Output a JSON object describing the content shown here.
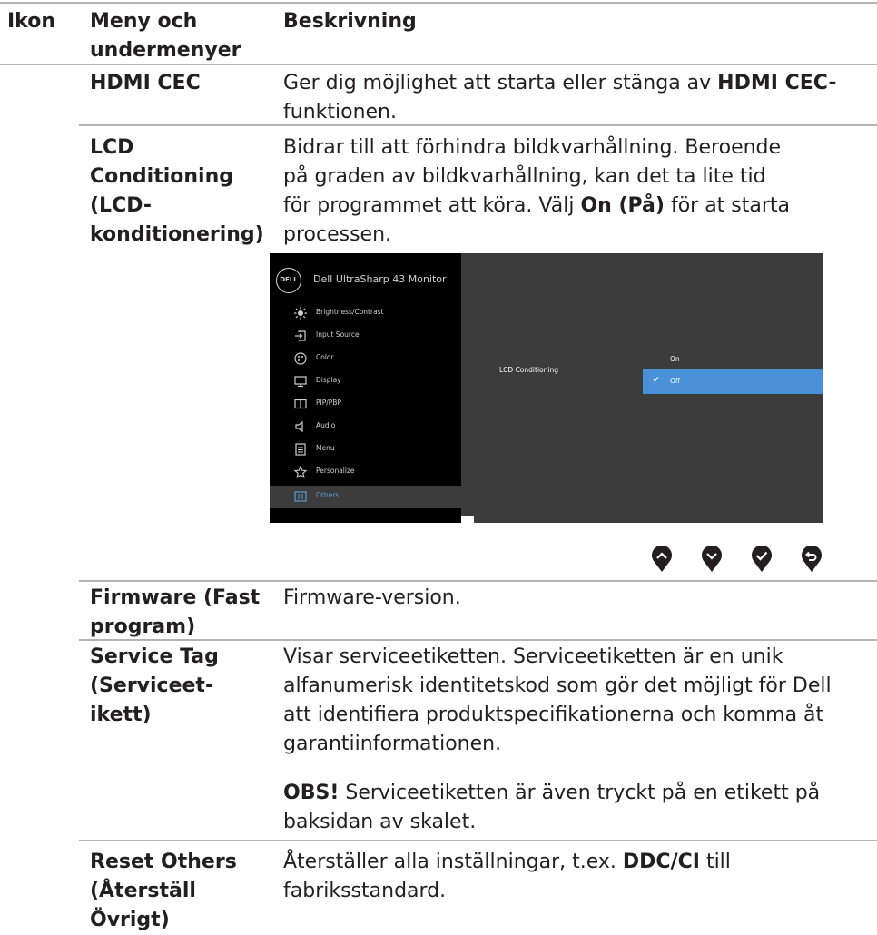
{
  "header": {
    "col_icon": "Ikon",
    "col_menu": "Meny och undermenyer",
    "col_menu_line1": "Meny och",
    "col_menu_line2": "undermenyer",
    "col_desc": "Beskrivning"
  },
  "rows": {
    "hdmi": {
      "menu": "HDMI CEC",
      "desc_prefix": "Ger dig möjlighet att starta eller stänga av ",
      "desc_bold": "HDMI CEC-",
      "desc_line2": "funktionen."
    },
    "lcd": {
      "menu_line1": "LCD",
      "menu_line2": "Conditioning",
      "menu_line3": "(LCD-",
      "menu_line4": "konditionering)",
      "desc_line1": "Bidrar till att förhindra bildkvarhållning. Beroende",
      "desc_line2": "på graden av bildkvarhållning, kan det ta lite tid",
      "desc_line3_prefix": "för programmet att köra. Välj ",
      "desc_line3_bold": "On (På)",
      "desc_line3_suffix": " för at starta",
      "desc_line4": "processen."
    },
    "firmware": {
      "menu_line1": "Firmware (Fast",
      "menu_line2": "program)",
      "desc": "Firmware-version."
    },
    "service": {
      "menu_line1": "Service Tag",
      "menu_line2": "(Serviceet-",
      "menu_line3": "ikett)",
      "desc_line1": "Visar serviceetiketten. Serviceetiketten är en unik",
      "desc_line2": "alfanumerisk identitetskod som gör det möjligt för Dell",
      "desc_line3": "att identifiera produktspecifikationerna och komma åt",
      "desc_line4": "garantiinformationen.",
      "note_bold": "OBS!",
      "note_line1": " Serviceetiketten är även tryckt på en etikett på",
      "note_line2": "baksidan av skalet."
    },
    "reset": {
      "menu_line1": "Reset Others",
      "menu_line2": "(Återställ",
      "menu_line3": "Övrigt)",
      "desc_line1_prefix": "Återställer alla inställningar, t.ex. ",
      "desc_line1_bold": "DDC/CI",
      "desc_line1_suffix": " till",
      "desc_line2": "fabriksstandard."
    }
  },
  "osd": {
    "logo": "DELL",
    "title": "Dell UltraSharp 43 Monitor",
    "menu_items": [
      {
        "label": "Brightness/Contrast",
        "icon": "brightness-icon"
      },
      {
        "label": "Input Source",
        "icon": "input-source-icon"
      },
      {
        "label": "Color",
        "icon": "color-icon"
      },
      {
        "label": "Display",
        "icon": "display-icon"
      },
      {
        "label": "PIP/PBP",
        "icon": "pip-pbp-icon"
      },
      {
        "label": "Audio",
        "icon": "audio-icon"
      },
      {
        "label": "Menu",
        "icon": "menu-icon"
      },
      {
        "label": "Personalize",
        "icon": "personalize-icon"
      },
      {
        "label": "Others",
        "icon": "others-icon",
        "selected": true
      }
    ],
    "submenu_label": "LCD Conditioning",
    "options": [
      {
        "label": "On",
        "selected": false
      },
      {
        "label": "Off",
        "selected": true
      }
    ],
    "accent_color": "#4a90d9"
  },
  "nav_buttons": [
    "up-button-icon",
    "down-button-icon",
    "check-button-icon",
    "back-button-icon"
  ]
}
